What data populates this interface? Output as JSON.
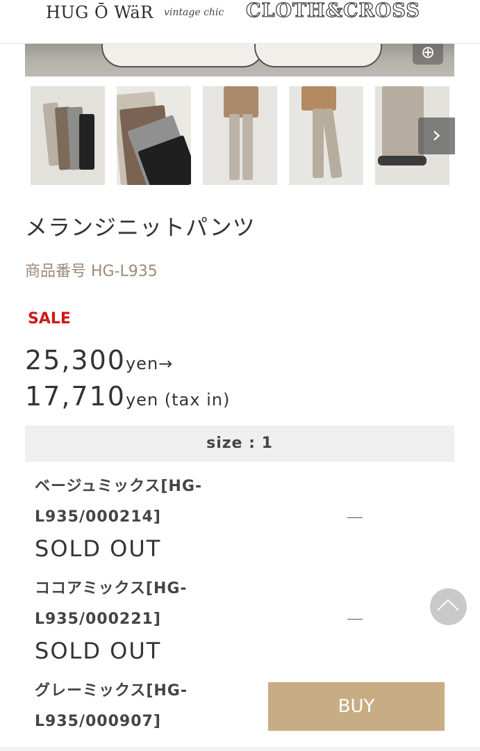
{
  "header": {
    "brand_primary": "HUG Ō WäR",
    "brand_script": "vintage chic",
    "brand_secondary": "CLOTH&CROSS"
  },
  "gallery": {
    "zoom_icon": "zoom-in-icon",
    "next_icon": "chevron-right-icon",
    "next_glyph": "›",
    "zoom_glyph": "⊕",
    "thumbnail_count": 5
  },
  "product": {
    "title": "メランジニットパンツ",
    "sku": "商品番号 HG-L935",
    "sale_label": "SALE",
    "original_price": "25,300",
    "original_unit": "yen→",
    "sale_price": "17,710",
    "sale_unit": "yen (tax in)"
  },
  "size_section": {
    "label": "size : 1"
  },
  "variants": [
    {
      "name": "ベージュミックス[HG-L935/000214]",
      "status": "SOLD OUT",
      "action": "—"
    },
    {
      "name": "ココアミックス[HG-L935/000221]",
      "status": "SOLD OUT",
      "action": "—"
    },
    {
      "name": "グレーミックス[HG-L935/000907]",
      "status": "",
      "action": "BUY"
    }
  ],
  "colors": {
    "accent": "#c8ad84",
    "sale": "#d01818",
    "sku": "#9c8978"
  }
}
